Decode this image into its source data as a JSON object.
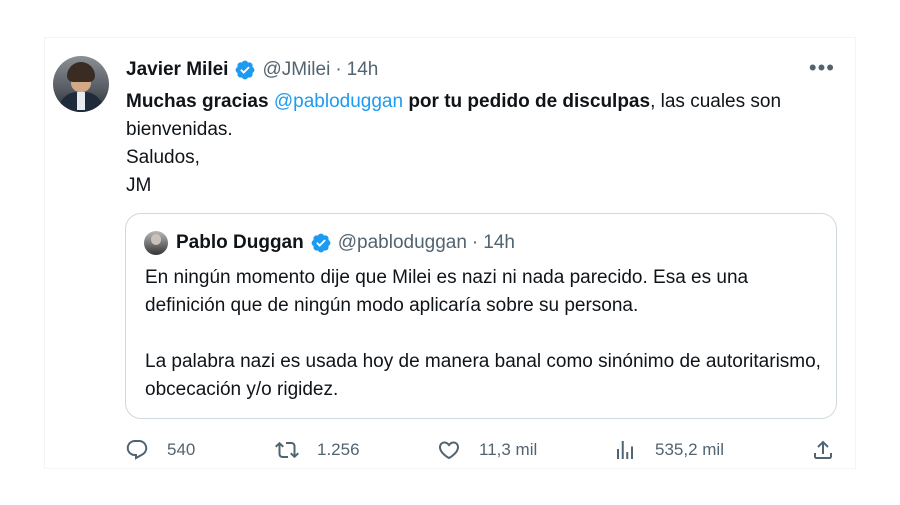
{
  "tweet": {
    "author_name": "Javier Milei",
    "handle": "@JMilei",
    "separator": "·",
    "time": "14h",
    "more_label": "•••",
    "body": {
      "bold_1": "Muchas gracias",
      "mention": "@pabloduggan",
      "bold_2": "por tu pedido de disculpas",
      "rest": ", las cuales son bienvenidas.",
      "line_2": "Saludos,",
      "line_3": "JM"
    }
  },
  "quoted_tweet": {
    "author_name": "Pablo Duggan",
    "handle": "@pabloduggan",
    "separator": "·",
    "time": "14h",
    "paragraph_1": "En ningún momento dije que Milei es nazi ni nada parecido. Esa es una definición que de ningún modo aplicaría sobre su persona.",
    "paragraph_2": "La palabra nazi es usada hoy de manera banal como sinónimo de autoritarismo, obcecación y/o rigidez."
  },
  "actions": {
    "replies": "540",
    "retweets": "1.256",
    "likes": "11,3 mil",
    "views": "535,2 mil"
  },
  "colors": {
    "accent": "#1d9bf0",
    "secondary_text": "#536471",
    "primary_text": "#0f1419",
    "border": "#cfd9de"
  },
  "icons": [
    "verified-badge-icon",
    "more-icon",
    "reply-icon",
    "retweet-icon",
    "like-icon",
    "views-icon",
    "share-icon"
  ]
}
